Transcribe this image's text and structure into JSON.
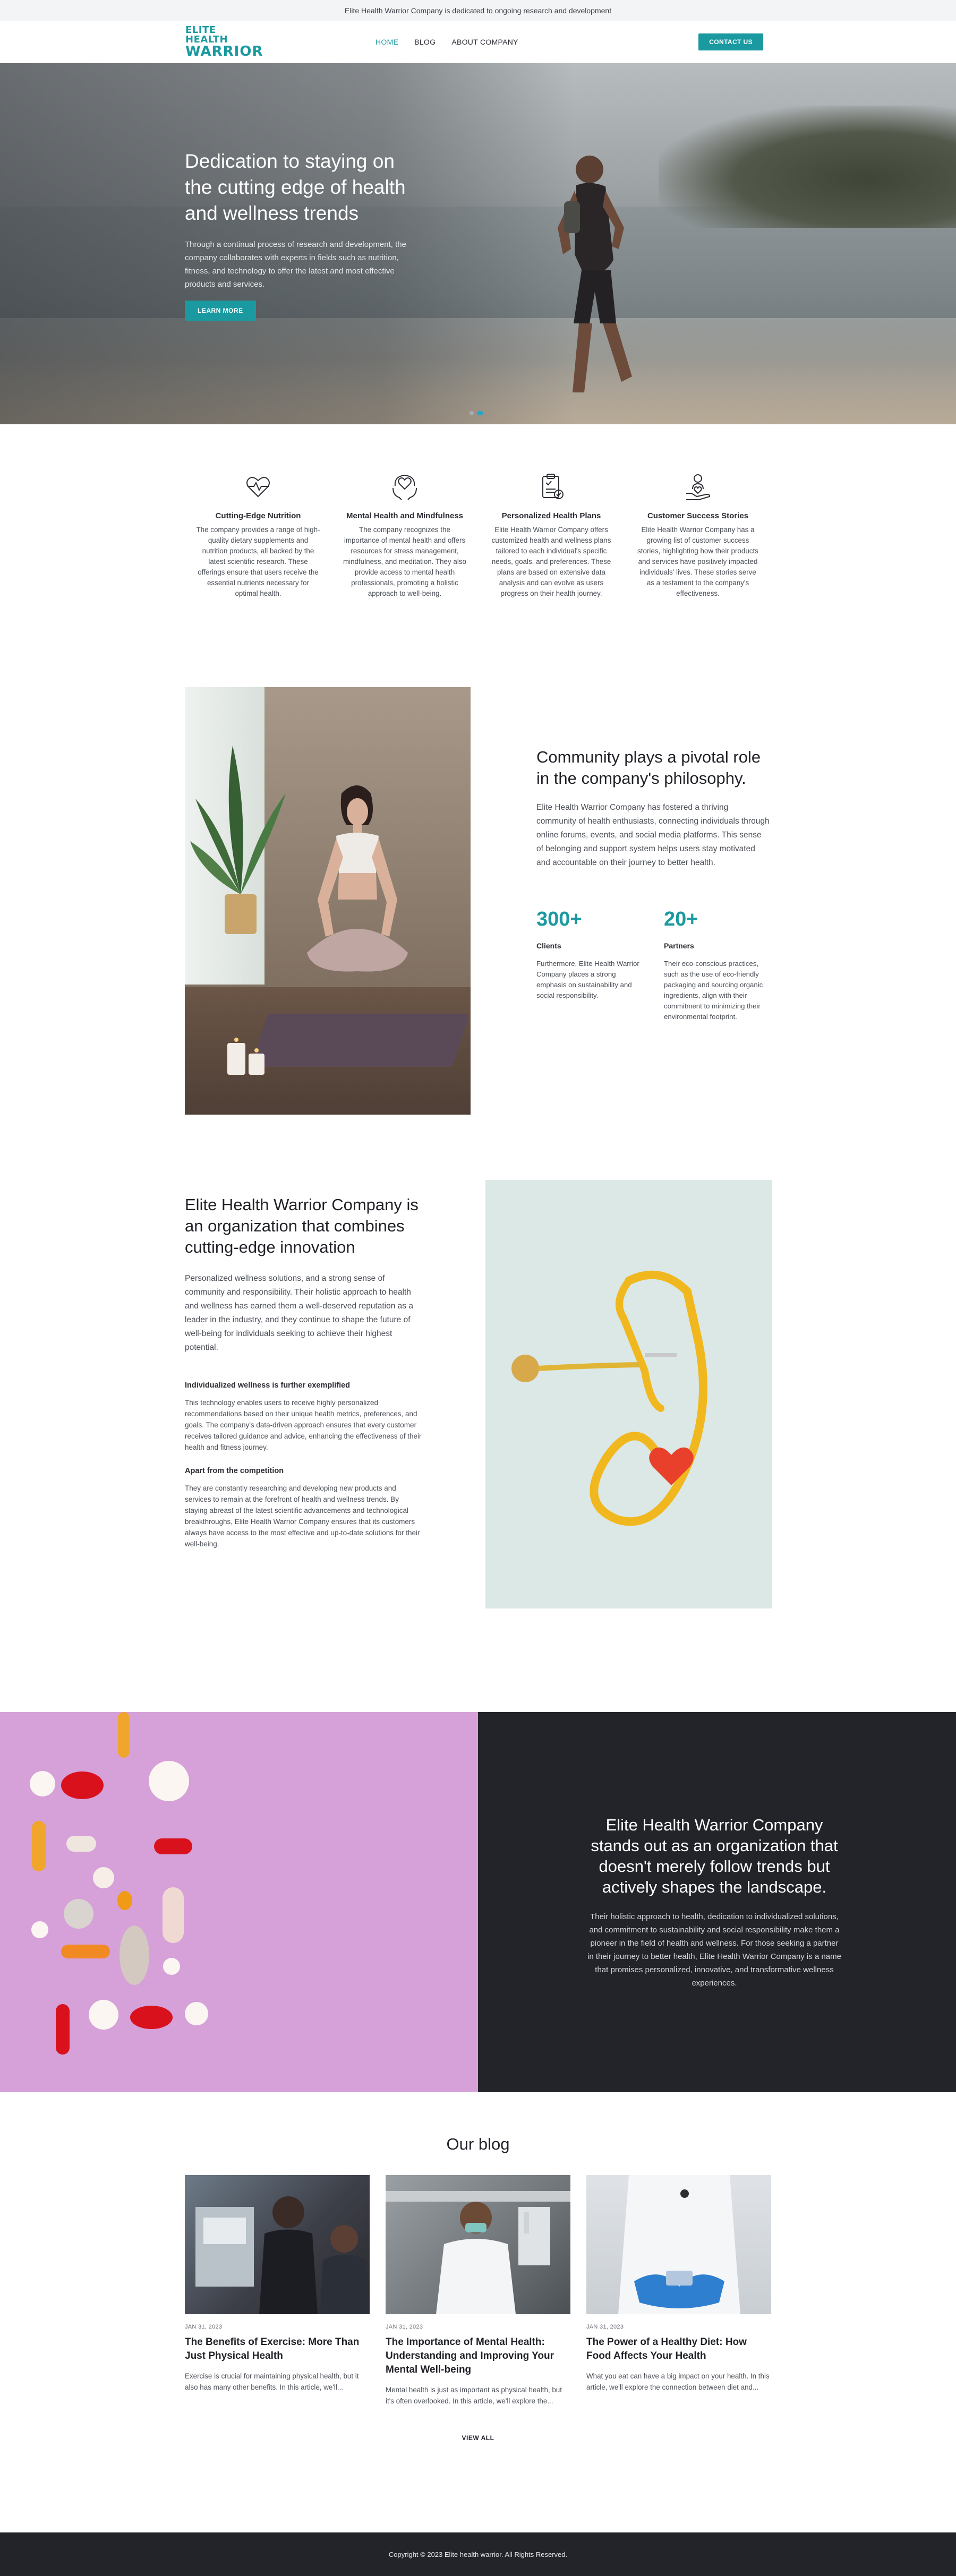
{
  "topbar": {
    "text": "Elite Health Warrior Company is dedicated to ongoing research and development"
  },
  "header": {
    "logo_line1": "ELITE HEALTH",
    "logo_line2": "WARRIOR",
    "nav": [
      {
        "label": "HOME",
        "active": true
      },
      {
        "label": "BLOG",
        "active": false
      },
      {
        "label": "ABOUT COMPANY",
        "active": false
      }
    ],
    "cta": "CONTACT US"
  },
  "hero": {
    "title": "Dedication to staying on the cutting edge of health and wellness trends",
    "description": "Through a continual process of research and development, the company collaborates with experts in fields such as nutrition, fitness, and technology to offer the latest and most effective products and services.",
    "button": "LEARN MORE",
    "slides": 2,
    "active_slide": 2
  },
  "features": [
    {
      "icon": "heart-pulse-icon",
      "title": "Cutting-Edge Nutrition",
      "text": "The company provides a range of high-quality dietary supplements and nutrition products, all backed by the latest scientific research. These offerings ensure that users receive the essential nutrients necessary for optimal health."
    },
    {
      "icon": "head-heart-hands-icon",
      "title": "Mental Health and Mindfulness",
      "text": "The company recognizes the importance of mental health and offers resources for stress management, mindfulness, and meditation. They also provide access to mental health professionals, promoting a holistic approach to well-being."
    },
    {
      "icon": "clipboard-plan-icon",
      "title": "Personalized Health Plans",
      "text": "Elite Health Warrior Company offers customized health and wellness plans tailored to each individual's specific needs, goals, and preferences. These plans are based on extensive data analysis and can evolve as users progress on their health journey."
    },
    {
      "icon": "person-heart-hand-icon",
      "title": "Customer Success Stories",
      "text": "Elite Health Warrior Company has a growing list of customer success stories, highlighting how their products and services have positively impacted individuals' lives. These stories serve as a testament to the company's effectiveness."
    }
  ],
  "community": {
    "title": "Community plays a pivotal role in the company's philosophy.",
    "description": "Elite Health Warrior Company has fostered a thriving community of health enthusiasts, connecting individuals through online forums, events, and social media platforms. This sense of belonging and support system helps users stay motivated and accountable on their journey to better health.",
    "stats": [
      {
        "number": "300+",
        "label": "Clients",
        "text": "Furthermore, Elite Health Warrior Company places a strong emphasis on sustainability and social responsibility."
      },
      {
        "number": "20+",
        "label": "Partners",
        "text": "Their eco-conscious practices, such as the use of eco-friendly packaging and sourcing organic ingredients, align with their commitment to minimizing their environmental footprint."
      }
    ]
  },
  "organization": {
    "title": "Elite Health Warrior Company is an organization that combines cutting-edge innovation",
    "description": "Personalized wellness solutions, and a strong sense of community and responsibility. Their holistic approach to health and wellness has earned them a well-deserved reputation as a leader in the industry, and they continue to shape the future of well-being for individuals seeking to achieve their highest potential.",
    "sub1_title": "Individualized wellness is further exemplified",
    "sub1_text": "This technology enables users to receive highly personalized recommendations based on their unique health metrics, preferences, and goals. The company's data-driven approach ensures that every customer receives tailored guidance and advice, enhancing the effectiveness of their health and fitness journey.",
    "sub2_title": "Apart from the competition",
    "sub2_text": "They are constantly researching and developing new products and services to remain at the forefront of health and wellness trends. By staying abreast of the latest scientific advancements and technological breakthroughs, Elite Health Warrior Company ensures that its customers always have access to the most effective and up-to-date solutions for their well-being."
  },
  "standout": {
    "title": "Elite Health Warrior Company stands out as an organization that doesn't merely follow trends but actively shapes the landscape.",
    "description": "Their holistic approach to health, dedication to individualized solutions, and commitment to sustainability and social responsibility make them a pioneer in the field of health and wellness. For those seeking a partner in their journey to better health, Elite Health Warrior Company is a name that promises personalized, innovative, and transformative wellness experiences."
  },
  "blog": {
    "title": "Our blog",
    "posts": [
      {
        "date": "JAN 31, 2023",
        "title": "The Benefits of Exercise: More Than Just Physical Health",
        "excerpt": "Exercise is crucial for maintaining physical health, but it also has many other benefits. In this article, we'll..."
      },
      {
        "date": "JAN 31, 2023",
        "title": "The Importance of Mental Health: Understanding and Improving Your Mental Well-being",
        "excerpt": "Mental health is just as important as physical health, but it's often overlooked. In this article, we'll explore the..."
      },
      {
        "date": "JAN 31, 2023",
        "title": "The Power of a Healthy Diet: How Food Affects Your Health",
        "excerpt": "What you eat can have a big impact on your health. In this article, we'll explore the connection between diet and..."
      }
    ],
    "view_all": "VIEW ALL"
  },
  "footer": {
    "copyright": "Copyright © 2023 Elite health warrior. All Rights Reserved."
  },
  "colors": {
    "accent": "#1a9aa0",
    "dark": "#22242a",
    "pills_bg": "#d6a1d9",
    "topbar_bg": "#f3f4f6"
  }
}
